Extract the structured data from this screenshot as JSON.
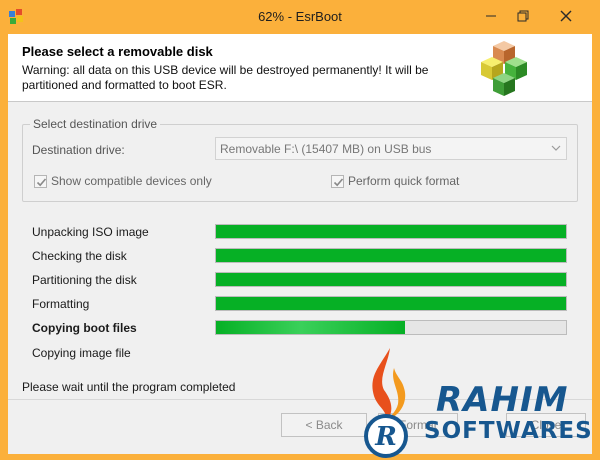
{
  "window": {
    "title": "62% - EsrBoot",
    "icon": "window-app-icon",
    "controls": {
      "minimize": "minimize-icon",
      "maximize": "maximize-icon",
      "close": "close-icon"
    }
  },
  "header": {
    "title": "Please select a removable disk",
    "warning": "Warning: all data on this USB device will be destroyed permanently! It will be partitioned and formatted to boot ESR.",
    "logo": "cubes-logo"
  },
  "destination": {
    "group_label": "Select destination drive",
    "drive_label": "Destination drive:",
    "selected_drive": "Removable  F:\\  (15407 MB)  on USB bus",
    "show_compatible": {
      "label": "Show compatible devices only",
      "checked": true
    },
    "quick_format": {
      "label": "Perform quick format",
      "checked": true
    }
  },
  "steps": [
    {
      "label": "Unpacking ISO image",
      "progress": 1.0,
      "active": false
    },
    {
      "label": "Checking the disk",
      "progress": 1.0,
      "active": false
    },
    {
      "label": "Partitioning the disk",
      "progress": 1.0,
      "active": false
    },
    {
      "label": "Formatting",
      "progress": 1.0,
      "active": false
    },
    {
      "label": "Copying boot files",
      "progress": 0.54,
      "active": true
    },
    {
      "label": "Copying image file",
      "progress": null,
      "active": false
    }
  ],
  "status": "Please wait until the program completed",
  "buttons": {
    "back": "< Back",
    "format": "Format",
    "close": "Close"
  },
  "watermark": {
    "line1": "RAHIM",
    "line2": "SOFTWARES",
    "brand_color": "#17578f"
  },
  "colors": {
    "title_bar": "#fbb03b",
    "progress_fill": "#06b025"
  }
}
